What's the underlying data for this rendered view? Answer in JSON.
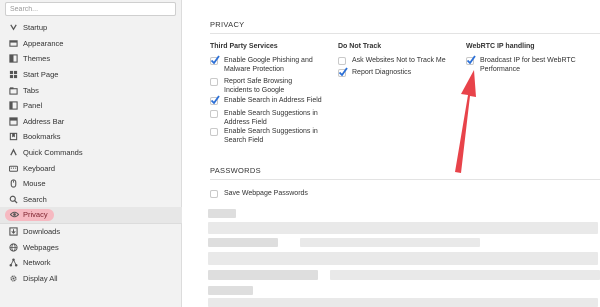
{
  "sidebar": {
    "search_placeholder": "Search...",
    "items": [
      {
        "label": "Startup",
        "icon": "chevron-icon"
      },
      {
        "label": "Appearance",
        "icon": "appearance-icon"
      },
      {
        "label": "Themes",
        "icon": "themes-icon"
      },
      {
        "label": "Start Page",
        "icon": "grid-icon"
      },
      {
        "label": "Tabs",
        "icon": "tabs-icon"
      },
      {
        "label": "Panel",
        "icon": "panel-icon"
      },
      {
        "label": "Address Bar",
        "icon": "address-bar-icon"
      },
      {
        "label": "Bookmarks",
        "icon": "bookmark-icon"
      },
      {
        "label": "Quick Commands",
        "icon": "quick-commands-icon"
      },
      {
        "label": "Keyboard",
        "icon": "keyboard-icon"
      },
      {
        "label": "Mouse",
        "icon": "mouse-icon"
      },
      {
        "label": "Search",
        "icon": "search-icon"
      },
      {
        "label": "Privacy",
        "icon": "eye-icon",
        "active": true
      },
      {
        "label": "Downloads",
        "icon": "download-icon"
      },
      {
        "label": "Webpages",
        "icon": "globe-icon"
      },
      {
        "label": "Network",
        "icon": "network-icon"
      },
      {
        "label": "Display All",
        "icon": "gear-icon"
      }
    ]
  },
  "privacy": {
    "title": "PRIVACY",
    "third_party": {
      "heading": "Third Party Services",
      "options": [
        {
          "label": "Enable Google Phishing and Malware Protection",
          "checked": true
        },
        {
          "label": "Report Safe Browsing Incidents to Google",
          "checked": false
        },
        {
          "label": "Enable Search in Address Field",
          "checked": true
        },
        {
          "label": "Enable Search Suggestions in Address Field",
          "checked": false
        },
        {
          "label": "Enable Search Suggestions in Search Field",
          "checked": false
        }
      ]
    },
    "do_not_track": {
      "heading": "Do Not Track",
      "options": [
        {
          "label": "Ask Websites Not to Track Me",
          "checked": false
        },
        {
          "label": "Report Diagnostics",
          "checked": true
        }
      ]
    },
    "webrtc": {
      "heading": "WebRTC IP handling",
      "options": [
        {
          "label": "Broadcast IP for best WebRTC Performance",
          "checked": true
        }
      ]
    }
  },
  "passwords": {
    "title": "PASSWORDS",
    "save_label": "Save Webpage Passwords",
    "save_checked": false
  },
  "colors": {
    "accent_check": "#2b6fd6",
    "annotation_arrow": "#e8434a",
    "active_highlight": "#f6b9c1"
  }
}
